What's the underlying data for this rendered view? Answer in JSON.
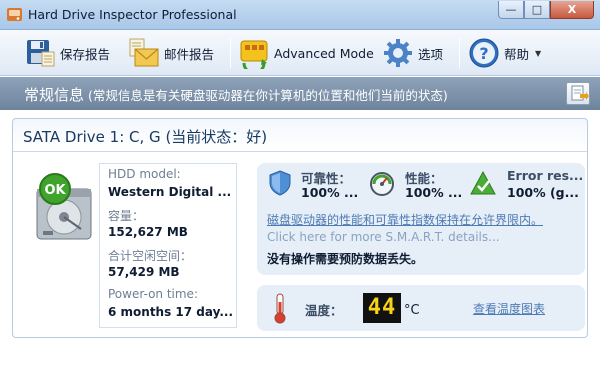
{
  "window": {
    "title": "Hard Drive Inspector Professional",
    "minimize_glyph": "—",
    "maximize_glyph": "□",
    "close_glyph": "X"
  },
  "toolbar": {
    "save_report": "保存报告",
    "mail_report": "邮件报告",
    "advanced_mode": "Advanced Mode",
    "options": "选项",
    "help": "帮助"
  },
  "section": {
    "title": "常规信息",
    "subtitle": "(常规信息是有关硬盘驱动器在你计算机的位置和他们当前的状态)"
  },
  "drive": {
    "title": "SATA Drive 1: C, G (当前状态：好)",
    "status_badge": "OK",
    "info": {
      "model_label": "HDD model:",
      "model_value": "Western Digital ...",
      "capacity_label": "容量：",
      "capacity_value": "152,627 MB",
      "free_label": "合计空闲空间：",
      "free_value": "57,429 MB",
      "power_on_label": "Power-on time:",
      "power_on_value": "6 months 17 day..."
    },
    "status": {
      "reliability_label": "可靠性：",
      "reliability_value": "100% ...",
      "performance_label": "性能：",
      "performance_value": "100% ...",
      "errors_label": "Error res...",
      "errors_value": "100% (g...",
      "summary_link": "磁盘驱动器的性能和可靠性指数保持在允许界限内。",
      "smart_link": "Click here for more S.M.A.R.T. details...",
      "note": "没有操作需要预防数据丢失。"
    },
    "temperature": {
      "label": "温度：",
      "value": "44",
      "unit": "°C",
      "history_link": "查看温度图表"
    }
  },
  "colors": {
    "ok_green": "#3fa42c",
    "link_blue": "#4d7bb3",
    "header_slate": "#7d91a9",
    "temp_digits": "#f7d21a"
  },
  "icons": {
    "app": "hard-drive-app-icon",
    "save_report": "floppy-disk-icon",
    "mail_report": "envelope-icon",
    "advanced_mode": "advanced-mode-icon",
    "options": "gear-icon",
    "help": "help-icon",
    "export": "export-icon",
    "reliability": "shield-icon",
    "performance": "speedometer-icon",
    "errors": "checkmark-icon",
    "temperature": "thermometer-icon"
  }
}
